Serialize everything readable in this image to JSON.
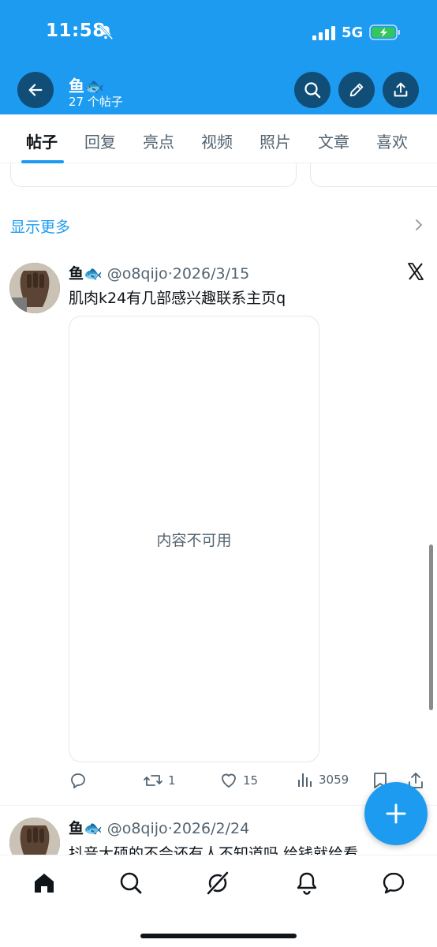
{
  "status_bar": {
    "time": "11:58",
    "network": "5G"
  },
  "header": {
    "name": "鱼🐟",
    "post_count": "27 个帖子"
  },
  "tabs": [
    {
      "label": "帖子",
      "active": true
    },
    {
      "label": "回复",
      "active": false
    },
    {
      "label": "亮点",
      "active": false
    },
    {
      "label": "视频",
      "active": false
    },
    {
      "label": "照片",
      "active": false
    },
    {
      "label": "文章",
      "active": false
    },
    {
      "label": "喜欢",
      "active": false
    }
  ],
  "show_more": "显示更多",
  "posts": [
    {
      "name": "鱼🐟",
      "handle": "@o8qijo",
      "date": "2026/3/15",
      "text": "肌肉k24有几部感兴趣联系主页q",
      "media_unavailable": "内容不可用",
      "retweets": "1",
      "likes": "15",
      "views": "3059"
    },
    {
      "name": "鱼🐟",
      "handle": "@o8qijo",
      "date": "2026/2/24",
      "text": "抖音大硕的不会还有人不知道吗 给钱就给看"
    }
  ],
  "colors": {
    "accent": "#1d9bf0",
    "header_button": "#104e78",
    "text_secondary": "#536471"
  },
  "icons": [
    "back-arrow-icon",
    "search-icon",
    "edit-icon",
    "share-icon",
    "reply-icon",
    "retweet-icon",
    "like-icon",
    "views-icon",
    "bookmark-icon",
    "x-logo-icon",
    "plus-icon",
    "home-icon",
    "explore-icon",
    "grok-icon",
    "bell-icon",
    "messages-icon"
  ]
}
